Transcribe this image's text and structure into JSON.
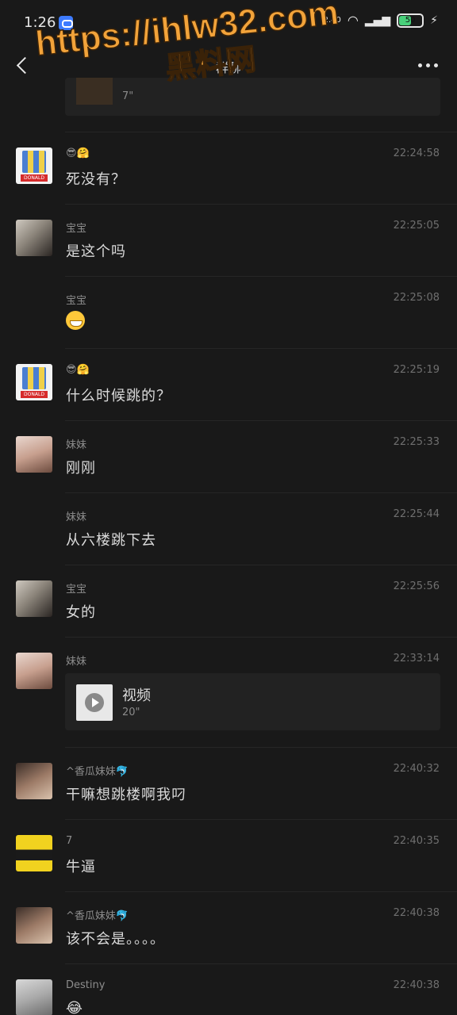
{
  "status": {
    "time": "1:26",
    "speed": "2.40",
    "battery": "50"
  },
  "header": {
    "title": "群聊"
  },
  "watermark": {
    "url": "https://ihlw32.com",
    "site": "黑料网"
  },
  "top_video": {
    "duration": "7\""
  },
  "messages": [
    {
      "sender": "😎🤗",
      "time": "22:24:58",
      "text": "死没有？",
      "avatar": "donald"
    },
    {
      "sender": "宝宝",
      "time": "22:25:05",
      "text": "是这个吗",
      "avatar": "baobao"
    },
    {
      "sender": "宝宝",
      "time": "22:25:08",
      "text": "",
      "emoji": "grin-emoji",
      "avatar": ""
    },
    {
      "sender": "😎🤗",
      "time": "22:25:19",
      "text": "什么时候跳的？",
      "avatar": "donald"
    },
    {
      "sender": "妹妹",
      "time": "22:25:33",
      "text": "刚刚",
      "avatar": "meimei"
    },
    {
      "sender": "妹妹",
      "time": "22:25:44",
      "text": "从六楼跳下去",
      "avatar": ""
    },
    {
      "sender": "宝宝",
      "time": "22:25:56",
      "text": "女的",
      "avatar": "baobao"
    },
    {
      "sender": "妹妹",
      "time": "22:33:14",
      "video": {
        "title": "视频",
        "duration": "20\""
      },
      "avatar": "meimei"
    },
    {
      "sender": "^香瓜妹妹🐬",
      "time": "22:40:32",
      "text": "干嘛想跳楼啊我叼",
      "avatar": "xiangua"
    },
    {
      "sender": "7",
      "time": "22:40:35",
      "text": "牛逼",
      "avatar": "seven"
    },
    {
      "sender": "^香瓜妹妹🐬",
      "time": "22:40:38",
      "text": "该不会是。。。。",
      "avatar": "xiangua"
    },
    {
      "sender": "Destiny",
      "time": "22:40:38",
      "text": "😂",
      "avatar": "destiny"
    }
  ]
}
